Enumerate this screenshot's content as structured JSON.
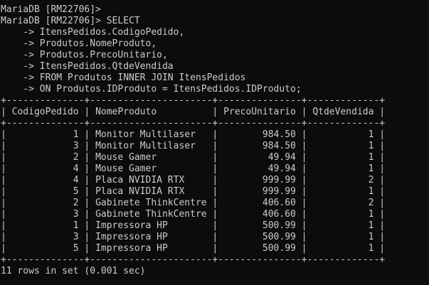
{
  "terminal": {
    "prompt_lines": [
      "MariaDB [RM22706]>",
      "MariaDB [RM22706]> SELECT"
    ],
    "continuation_prefix": "    -> ",
    "query_continuations": [
      "ItensPedidos.CodigoPedido,",
      "Produtos.NomeProduto,",
      "Produtos.PrecoUnitario,",
      "ItensPedidos.QtdeVendida",
      "FROM Produtos INNER JOIN ItensPedidos",
      "ON Produtos.IDProduto = ItensPedidos.IDProduto;"
    ],
    "result": {
      "columns": [
        "CodigoPedido",
        "NomeProduto",
        "PrecoUnitario",
        "QtdeVendida"
      ],
      "rows": [
        [
          "1",
          "Monitor Multilaser",
          "984.50",
          "1"
        ],
        [
          "3",
          "Monitor Multilaser",
          "984.50",
          "1"
        ],
        [
          "2",
          "Mouse Gamer",
          "49.94",
          "1"
        ],
        [
          "4",
          "Mouse Gamer",
          "49.94",
          "1"
        ],
        [
          "4",
          "Placa NVIDIA RTX",
          "999.99",
          "2"
        ],
        [
          "5",
          "Placa NVIDIA RTX",
          "999.99",
          "1"
        ],
        [
          "2",
          "Gabinete ThinkCentre",
          "406.60",
          "2"
        ],
        [
          "3",
          "Gabinete ThinkCentre",
          "406.60",
          "1"
        ],
        [
          "1",
          "Impressora HP",
          "500.99",
          "1"
        ],
        [
          "3",
          "Impressora HP",
          "500.99",
          "1"
        ],
        [
          "5",
          "Impressora HP",
          "500.99",
          "1"
        ]
      ]
    },
    "footer": "11 rows in set (0.001 sec)",
    "colors": {
      "background": "#0c0c0c",
      "foreground": "#cccccc"
    }
  }
}
